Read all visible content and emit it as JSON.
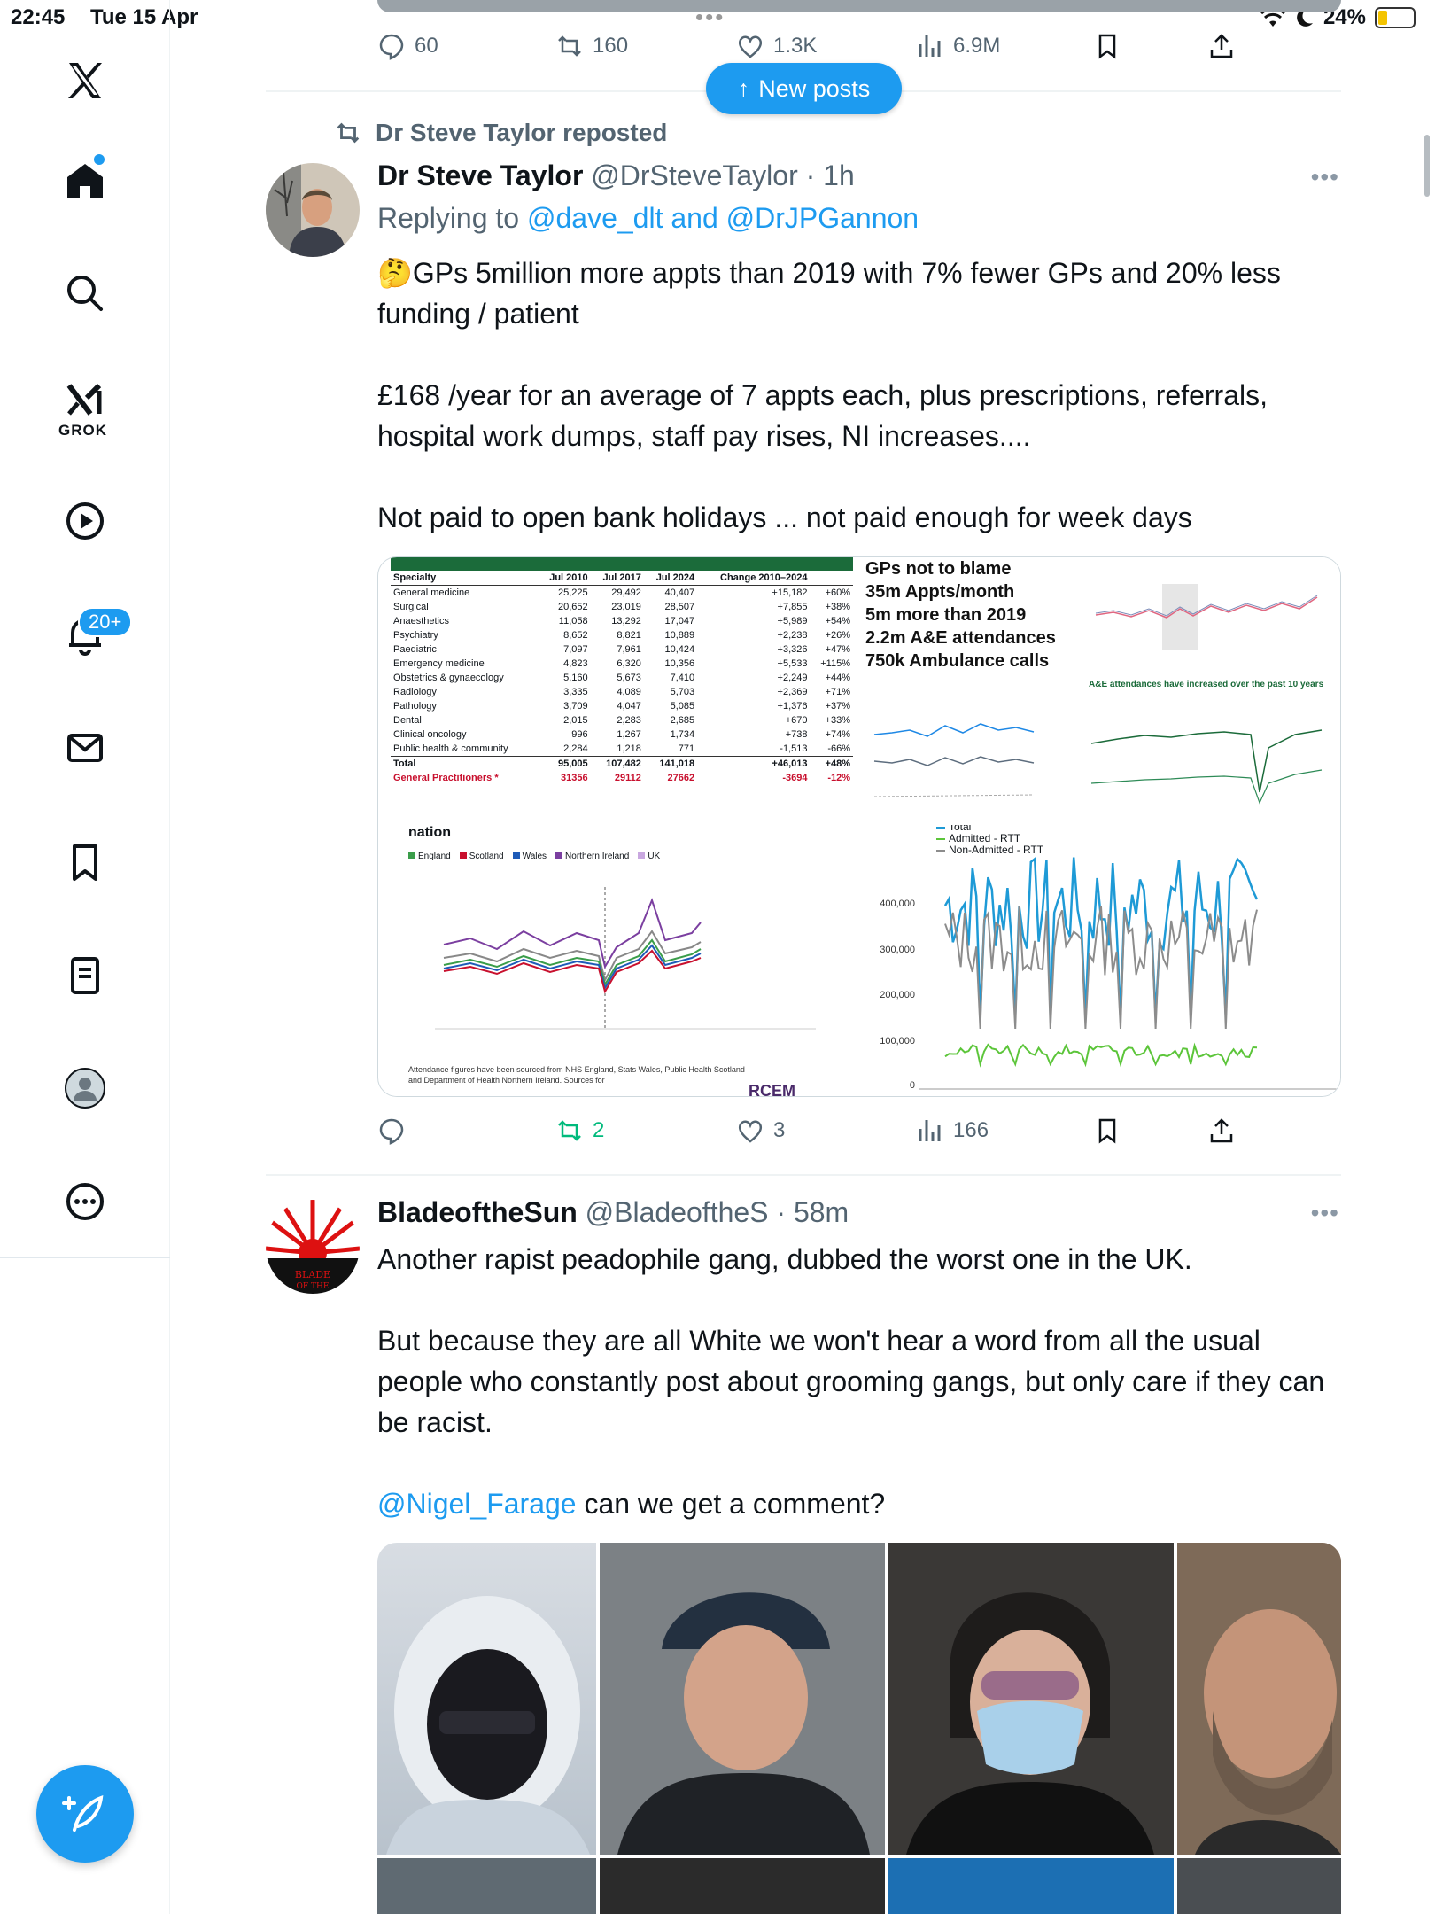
{
  "status_bar": {
    "time": "22:45",
    "date": "Tue 15 Apr",
    "battery": "24%"
  },
  "sidebar": {
    "items": [
      "home",
      "search",
      "grok",
      "videos",
      "notifications",
      "messages",
      "bookmarks",
      "lists",
      "profile",
      "more"
    ],
    "grok_label": "GROK",
    "notifications_badge": "20+"
  },
  "prev_post_actions": {
    "replies": "60",
    "reposts": "160",
    "likes": "1.3K",
    "views": "6.9M"
  },
  "new_posts_label": "New posts",
  "post1": {
    "repost_label": "Dr Steve Taylor reposted",
    "name": "Dr Steve Taylor",
    "handle": "@DrSteveTaylor",
    "time": "1h",
    "replying_prefix": "Replying to",
    "replying_1": "@dave_dlt",
    "replying_and": "and",
    "replying_2": "@DrJPGannon",
    "text": "🤔GPs 5million more appts than 2019 with 7% fewer GPs and 20% less funding / patient\n\n£168 /year for an average of 7 appts each, plus prescriptions, referrals, hospital work dumps, staff pay rises, NI increases....\n\nNot paid to open bank holidays ... not paid enough for week days",
    "actions": {
      "replies": "",
      "reposts": "2",
      "likes": "3",
      "views": "166"
    },
    "media": {
      "table_header": [
        "Specialty",
        "Jul 2010",
        "Jul 2017",
        "Jul 2024",
        "Change 2010–2024",
        ""
      ],
      "table_rows": [
        [
          "General medicine",
          "25,225",
          "29,492",
          "40,407",
          "+15,182",
          "+60%"
        ],
        [
          "Surgical",
          "20,652",
          "23,019",
          "28,507",
          "+7,855",
          "+38%"
        ],
        [
          "Anaesthetics",
          "11,058",
          "13,292",
          "17,047",
          "+5,989",
          "+54%"
        ],
        [
          "Psychiatry",
          "8,652",
          "8,821",
          "10,889",
          "+2,238",
          "+26%"
        ],
        [
          "Paediatric",
          "7,097",
          "7,961",
          "10,424",
          "+3,326",
          "+47%"
        ],
        [
          "Emergency medicine",
          "4,823",
          "6,320",
          "10,356",
          "+5,533",
          "+115%"
        ],
        [
          "Obstetrics & gynaecology",
          "5,160",
          "5,673",
          "7,410",
          "+2,249",
          "+44%"
        ],
        [
          "Radiology",
          "3,335",
          "4,089",
          "5,703",
          "+2,369",
          "+71%"
        ],
        [
          "Pathology",
          "3,709",
          "4,047",
          "5,085",
          "+1,376",
          "+37%"
        ],
        [
          "Dental",
          "2,015",
          "2,283",
          "2,685",
          "+670",
          "+33%"
        ],
        [
          "Clinical oncology",
          "996",
          "1,267",
          "1,734",
          "+738",
          "+74%"
        ],
        [
          "Public health & community",
          "2,284",
          "1,218",
          "771",
          "-1,513",
          "-66%"
        ]
      ],
      "table_total": [
        "Total",
        "95,005",
        "107,482",
        "141,018",
        "+46,013",
        "+48%"
      ],
      "table_gp": [
        "General Practitioners *",
        "31356",
        "29112",
        "27662",
        "-3694",
        "-12%"
      ],
      "headline_lines": [
        "GPs not to blame",
        "35m Appts/month",
        "5m more than 2019",
        "2.2m A&E attendances",
        "750k Ambulance calls"
      ],
      "ae_chart_title": "A&E attendances have increased over the past 10 years",
      "nation_title": "nation",
      "nation_legend": [
        "England",
        "Scotland",
        "Wales",
        "Northern Ireland",
        "UK"
      ],
      "nation_caption": "Attendance figures have been sourced from NHS England, Stats Wales, Public Health Scotland and Department of Health Northern Ireland. Sources for",
      "rcem": "RCEM",
      "rtt_legend": [
        "Total",
        "Admitted - RTT",
        "Non-Admitted - RTT"
      ],
      "rtt_ticks": [
        "400,000",
        "300,000",
        "200,000",
        "100,000",
        "0"
      ]
    }
  },
  "post2": {
    "name": "BladeoftheSun",
    "handle": "@BladeoftheS",
    "time": "58m",
    "text_1": "Another rapist peadophile gang, dubbed the worst one in the UK.\n\nBut because they are all White we won't hear a word from all the usual people who constantly post about grooming gangs, but only care if they can be racist.\n\n",
    "mention": "@Nigel_Farage",
    "text_2": " can we get a comment?",
    "avatar_text": "BLADE OF THE"
  },
  "colors": {
    "accent": "#1d9bf0",
    "secondary_text": "#536471",
    "repost_green": "#00ba7c"
  }
}
